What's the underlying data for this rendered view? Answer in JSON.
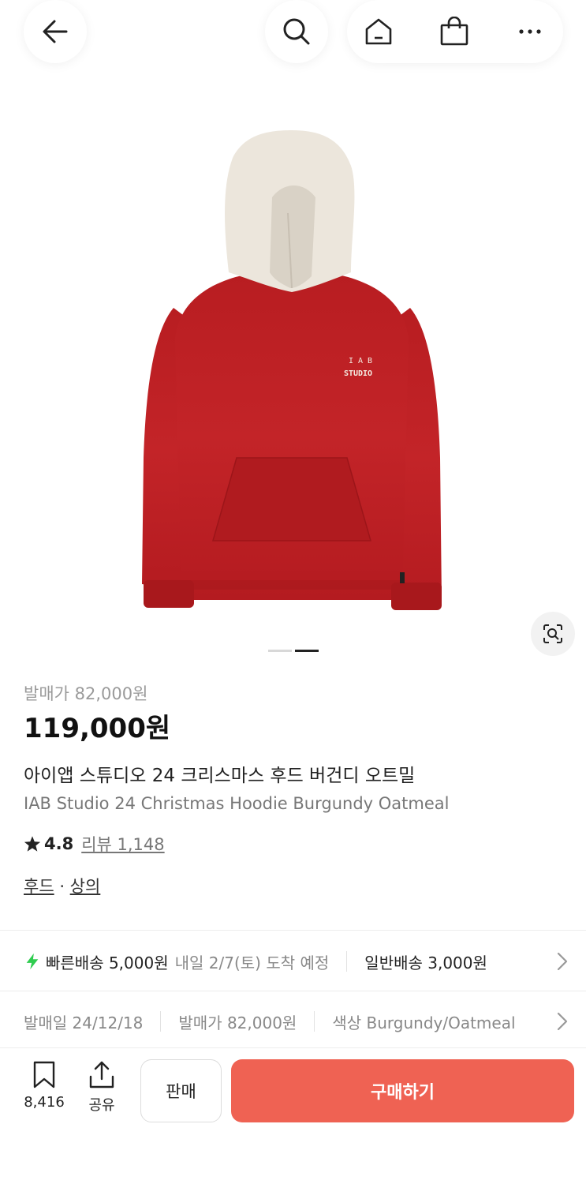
{
  "colors": {
    "accent": "#ef6253",
    "bolt": "#2fcc4f",
    "hoodie_body": "#c01f22",
    "hood": "#ece6dc"
  },
  "nav": {
    "back_icon": "arrow-left-icon",
    "search_icon": "search-icon",
    "home_icon": "home-icon",
    "cart_icon": "shopping-bag-icon",
    "more_icon": "more-horizontal-icon"
  },
  "product_image": {
    "logo_line1": "I A B",
    "logo_line2": "STUDIO",
    "slide_index": 2,
    "slide_count": 2
  },
  "product": {
    "release_price": "발매가 82,000원",
    "price": "119,000원",
    "title_ko": "아이앱 스튜디오 24 크리스마스 후드 버건디 오트밀",
    "title_en": "IAB Studio 24 Christmas Hoodie Burgundy Oatmeal",
    "rating": "4.8",
    "review_label": "리뷰 1,148",
    "category_1": "후드",
    "category_sep": " · ",
    "category_2": "상의"
  },
  "shipping": {
    "fast_label": "빠른배송 5,000원",
    "fast_date": "내일 2/7(토) 도착 예정",
    "normal_label": "일반배송 3,000원"
  },
  "specs": {
    "release_date": "발매일 24/12/18",
    "release_price": "발매가 82,000원",
    "color": "색상 Burgundy/Oatmeal"
  },
  "bottom": {
    "wishlist_count": "8,416",
    "share_label": "공유",
    "sell_label": "판매",
    "buy_label": "구매하기"
  }
}
